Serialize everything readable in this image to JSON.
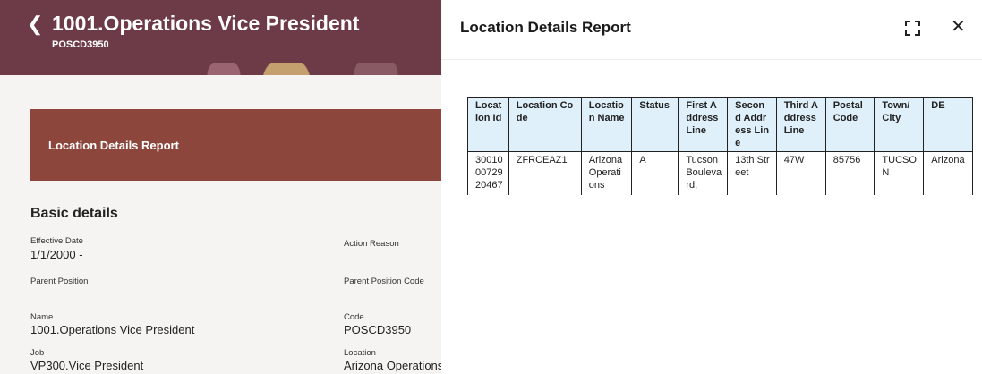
{
  "header": {
    "title": "1001.Operations Vice President",
    "subtitle": "POSCD3950"
  },
  "report_card": {
    "label": "Location Details Report"
  },
  "basic": {
    "title": "Basic details",
    "effective_date_label": "Effective Date",
    "effective_date_value": "1/1/2000 -",
    "action_reason_label": "Action Reason",
    "parent_position_label": "Parent Position",
    "parent_position_code_label": "Parent Position Code",
    "name_label": "Name",
    "name_value": "1001.Operations Vice President",
    "code_label": "Code",
    "code_value": "POSCD3950",
    "job_label": "Job",
    "job_value": "VP300.Vice President",
    "location_label": "Location",
    "location_value": "Arizona Operations"
  },
  "panel": {
    "title": "Location Details Report",
    "icons": {
      "expand": "expand-icon",
      "close": "close-icon"
    }
  },
  "report": {
    "headers": [
      "Location Id",
      "Location Code",
      "Location Name",
      "Status",
      "First Address Line",
      "Second Address Line",
      "Third Address Line",
      "Postal Code",
      "Town/ City",
      "DE"
    ],
    "row": [
      "300100072920467",
      "ZFRCEAZ1",
      "Arizona Operations",
      "A",
      "Tucson Boulevard,",
      "13th Street",
      "47W",
      "85756",
      "TUCSON",
      "Arizona"
    ]
  },
  "colors": {
    "header_bg": "#6d3a48",
    "report_card_bg": "#8c463c",
    "table_header_bg": "#dff0fb"
  }
}
